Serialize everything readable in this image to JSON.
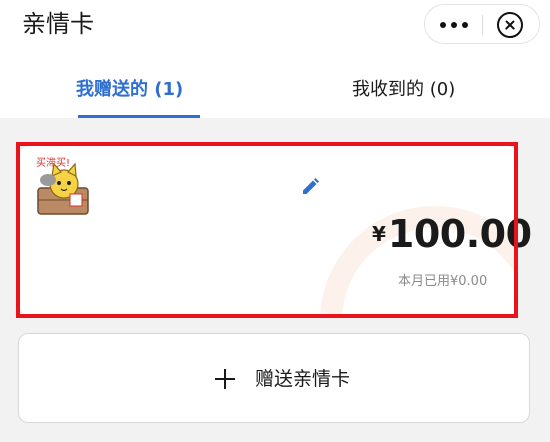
{
  "titlebar": {
    "title": "亲情卡",
    "more_icon": "more-dots-icon",
    "close_icon": "close-circle-icon"
  },
  "tabs": [
    {
      "label": "我赠送的 (1)",
      "active": true
    },
    {
      "label": "我收到的 (0)",
      "active": false
    }
  ],
  "colors": {
    "accent": "#2f6fd1",
    "highlight": "#e8141c",
    "page_bg": "#f2f2f2"
  },
  "card": {
    "sticker_text": "买滞买!",
    "edit_icon": "edit-pencil-icon",
    "currency": "¥",
    "amount": "100.00",
    "used": "本月已用¥0.00"
  },
  "give_button": {
    "icon": "plus-icon",
    "label": "赠送亲情卡"
  }
}
